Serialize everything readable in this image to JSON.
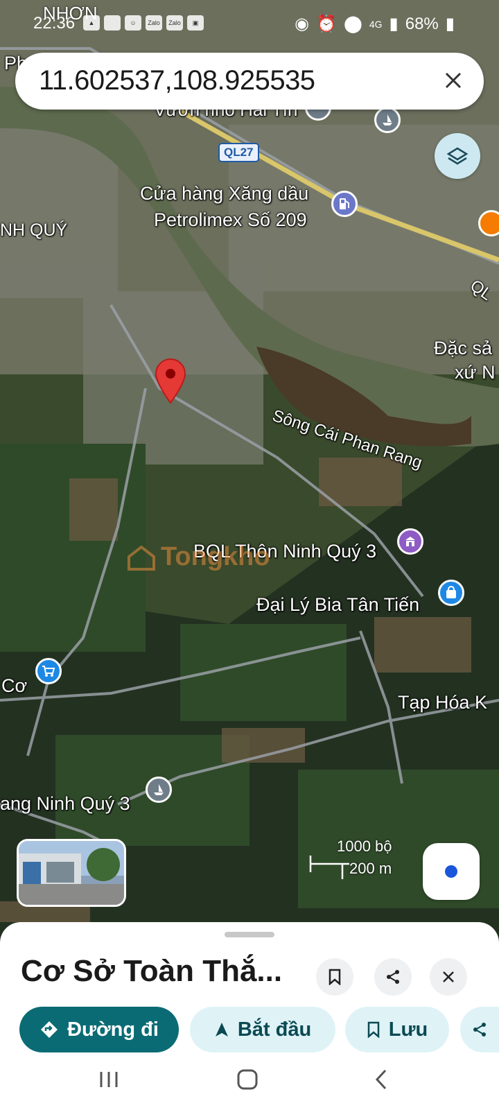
{
  "status_bar": {
    "time": "22:36",
    "carrier_text": "NHƠN",
    "notification_icons": [
      "zalo-icon",
      "zalo-icon"
    ],
    "zalo_label": "Zalo",
    "network": "4G",
    "battery": "68%"
  },
  "search": {
    "query": "11.602537,108.925535"
  },
  "map": {
    "labels": {
      "top_left": "Ph",
      "vuon_nho": "Vườn nho Hai Tín",
      "road_ql27": "QL27",
      "petrol_line1": "Cửa hàng Xăng dầu",
      "petrol_line2": "Petrolimex Số 209",
      "ninh_quy": "NH QUÝ",
      "ql_right": "QL",
      "dac_san_1": "Đặc sả",
      "dac_san_2": "xứ N",
      "river": "Sông Cái Phan Rang",
      "bql": "BQL Thôn Ninh Quý 3",
      "dai_ly": "Đại Lý Bia Tân Tiến",
      "co": "Cơ",
      "tap_hoa": "Tạp Hóa K",
      "ninh_quy_3": "ang Ninh Quý 3"
    },
    "watermark": "Tongkho",
    "scale": {
      "imperial": "1000 bộ",
      "metric": "200 m"
    },
    "colors": {
      "marker": "#e53935",
      "poi_blue": "#1e88e5",
      "poi_purple": "#8e5cc4",
      "poi_gray": "#6f7d88",
      "poi_orange": "#f57c00",
      "route_yellow": "#d9c66a"
    }
  },
  "sheet": {
    "place_name": "Cơ Sở Toàn Thắ...",
    "actions": {
      "directions": "Đường đi",
      "start": "Bắt đầu",
      "save": "Lưu"
    },
    "colors": {
      "primary": "#0b6b74",
      "secondary": "#dff3f7"
    }
  }
}
